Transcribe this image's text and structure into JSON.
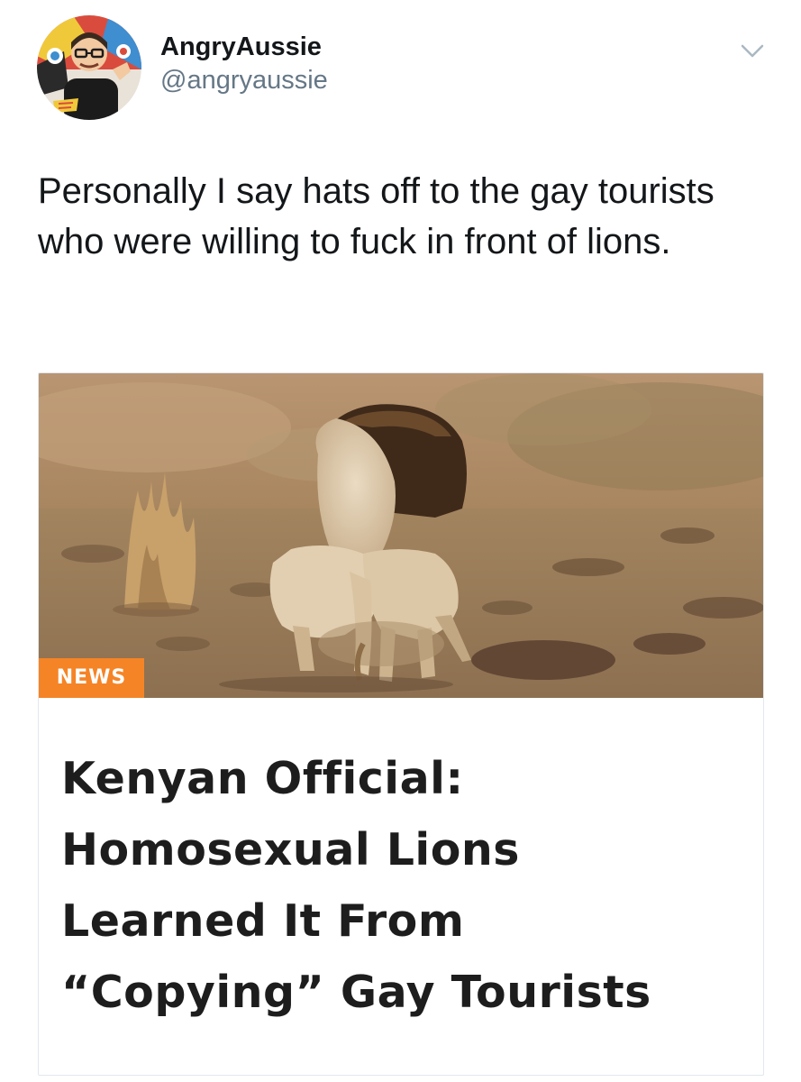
{
  "author": {
    "display_name": "AngryAussie",
    "handle": "@angryaussie",
    "avatar": "avatar-illustration"
  },
  "tweet": {
    "text": "Personally I say hats off to the gay tourists who were willing to fuck in front of lions."
  },
  "card": {
    "image": "lion-photo",
    "badge": "NEWS",
    "headline_lines": [
      "Kenyan Official:",
      "Homosexual Lions",
      "Learned It From",
      "“Copying” Gay Tourists"
    ]
  },
  "icons": {
    "menu": "chevron-down-icon"
  },
  "colors": {
    "handle": "#657786",
    "badge": "#f58426",
    "text": "#14171a"
  }
}
